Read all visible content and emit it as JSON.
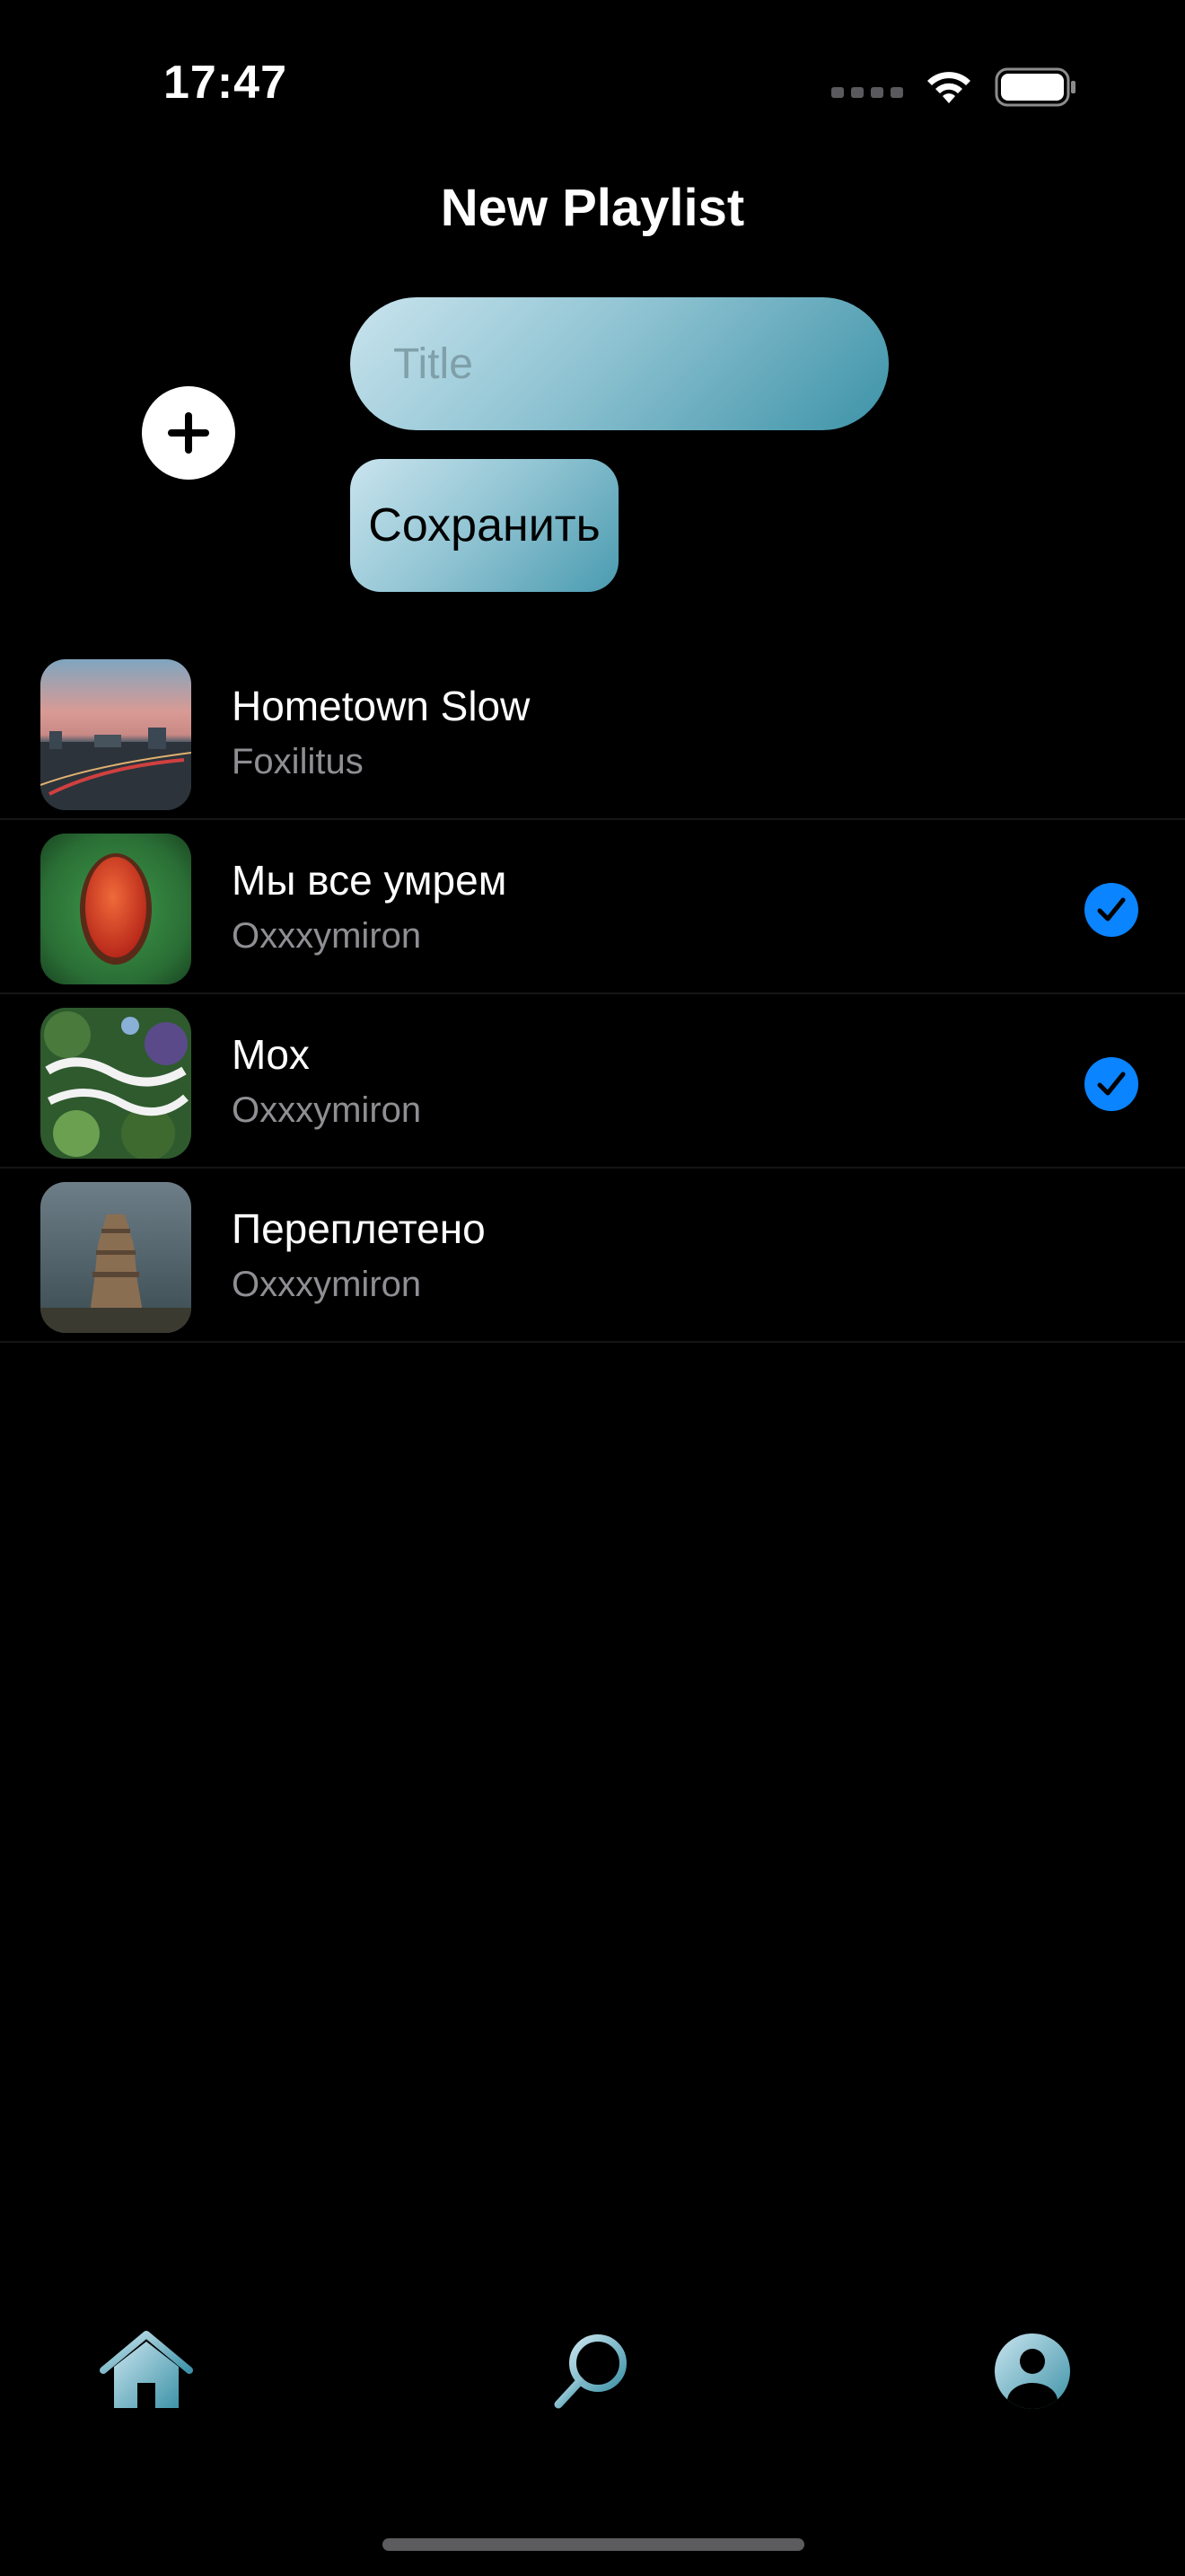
{
  "status_bar": {
    "time": "17:47"
  },
  "header": {
    "title": "New Playlist"
  },
  "form": {
    "title_placeholder": "Title",
    "title_value": "",
    "save_label": "Сохранить"
  },
  "tracks": [
    {
      "title": "Hometown Slow",
      "artist": "Foxilitus",
      "selected": false
    },
    {
      "title": "Мы все умрем",
      "artist": "Oxxxymiron",
      "selected": true
    },
    {
      "title": "Mox",
      "artist": "Oxxxymiron",
      "selected": true
    },
    {
      "title": "Переплетено",
      "artist": "Oxxxymiron",
      "selected": false
    }
  ],
  "tab_bar": {
    "items": [
      "house-icon",
      "magnifying-glass-icon",
      "person-circle-icon"
    ]
  },
  "colors": {
    "background": "#000000",
    "accent_blue": "#0a84ff",
    "gradient_light": "#c9e4ee",
    "gradient_dark": "#3e93a8",
    "secondary_text": "#8e8e93"
  }
}
